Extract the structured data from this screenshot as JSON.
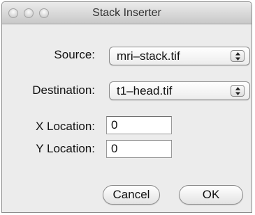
{
  "window": {
    "title": "Stack Inserter"
  },
  "form": {
    "source_label": "Source:",
    "source_value": "mri–stack.tif",
    "destination_label": "Destination:",
    "destination_value": "t1–head.tif",
    "x_label": "X Location:",
    "x_value": "0",
    "y_label": "Y Location:",
    "y_value": "0"
  },
  "buttons": {
    "cancel_label": "Cancel",
    "ok_label": "OK"
  },
  "icons": {
    "close": "close-button-icon",
    "minimize": "minimize-button-icon",
    "zoom": "zoom-button-icon",
    "popup_arrows": "up-down-arrows-icon"
  }
}
